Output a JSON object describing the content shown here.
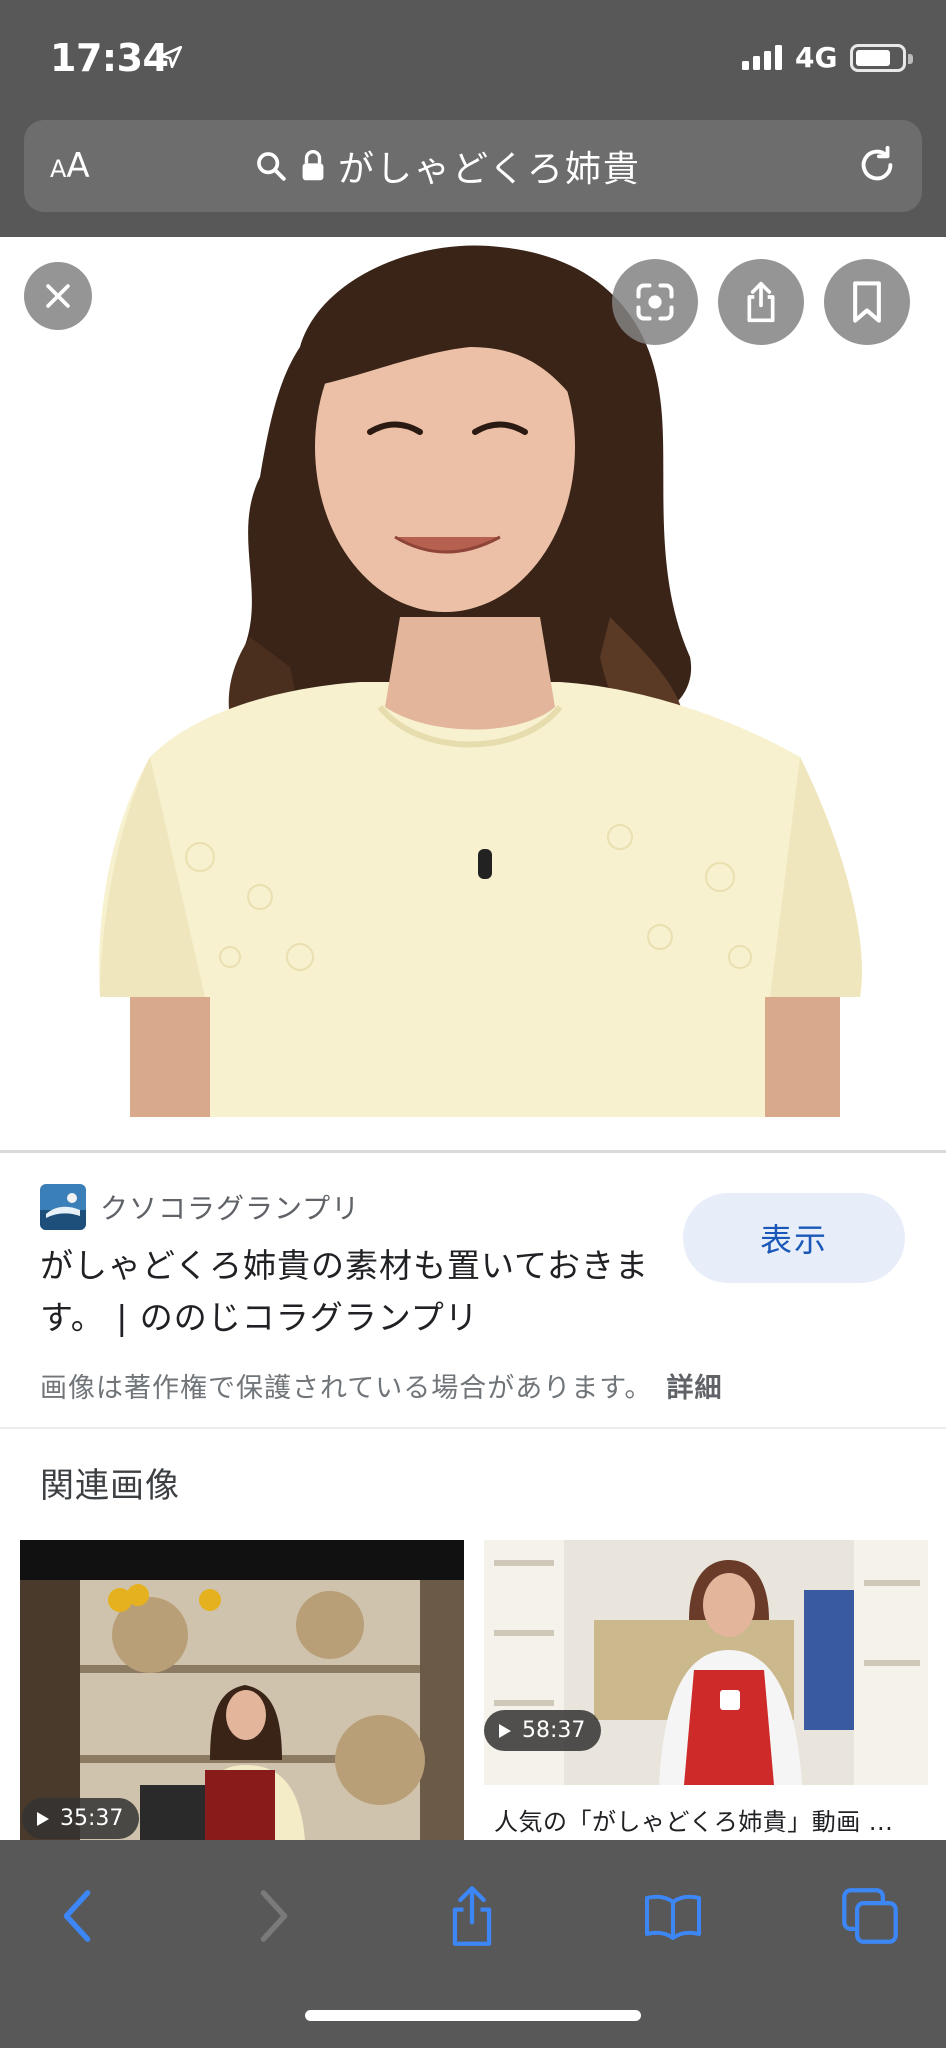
{
  "status": {
    "time": "17:34",
    "network": "4G"
  },
  "browser": {
    "text_size_small": "A",
    "text_size_big": "A",
    "address": "がしゃどくろ姉貴"
  },
  "viewer": {
    "image_alt": "Woman in pale yellow lace top smiling"
  },
  "result": {
    "source_name": "クソコラグランプリ",
    "title": "がしゃどくろ姉貴の素材も置いておきます。 | ののじコラグランプリ",
    "visit_label": "表示",
    "copyright_notice": "画像は著作権で保護されている場合があります。",
    "more_link": "詳細"
  },
  "related": {
    "heading": "関連画像",
    "items": [
      {
        "duration": "35:37",
        "caption": ""
      },
      {
        "duration": "58:37",
        "caption": "人気の「がしゃどくろ姉貴」動画 ..."
      }
    ]
  },
  "colors": {
    "chrome_bg": "#585858",
    "link_blue": "#1a57b8",
    "button_bg": "#e7eef9",
    "toolbar_blue": "#3d86f5"
  }
}
